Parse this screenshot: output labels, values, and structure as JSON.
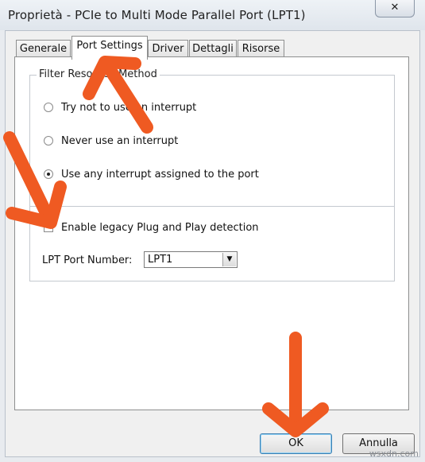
{
  "window": {
    "title": "Proprietà - PCIe to Multi Mode Parallel Port (LPT1)",
    "close_symbol": "✕"
  },
  "tabs": [
    {
      "label": "Generale",
      "active": false
    },
    {
      "label": "Port Settings",
      "active": true
    },
    {
      "label": "Driver",
      "active": false
    },
    {
      "label": "Dettagli",
      "active": false
    },
    {
      "label": "Risorse",
      "active": false
    }
  ],
  "port_settings": {
    "group_title": "Filter Resource Method",
    "options": [
      {
        "label": "Try not to use an interrupt",
        "checked": false
      },
      {
        "label": "Never use an interrupt",
        "checked": false
      },
      {
        "label": "Use any interrupt assigned to the port",
        "checked": true
      }
    ],
    "legacy_pnp_label": "Enable legacy Plug and Play detection",
    "legacy_pnp_checked": false,
    "lpt_port_label": "LPT Port Number:",
    "lpt_port_value": "LPT1"
  },
  "buttons": {
    "ok": "OK",
    "cancel": "Annulla"
  },
  "watermark": "wsxdn.com",
  "colors": {
    "annotation_arrow": "#ef5a22"
  },
  "icons": {
    "close": "close-icon",
    "dropdown": "chevron-down-icon"
  }
}
